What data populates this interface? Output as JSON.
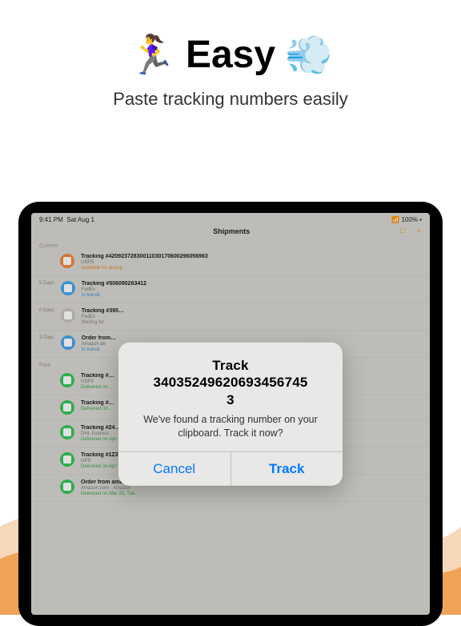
{
  "hero": {
    "emoji_left": "🏃‍♀️",
    "title": "Easy",
    "emoji_right": "💨",
    "subtitle": "Paste tracking numbers easily"
  },
  "status": {
    "time": "9:41 PM",
    "date": "Sat Aug 1",
    "wifi": "📶",
    "battery": "100%"
  },
  "header": {
    "title": "Shipments"
  },
  "sections": {
    "current": "Current",
    "past": "Past"
  },
  "current": [
    {
      "badge": "orange",
      "days": "",
      "title": "Tracking #42092372830011030170600296056963",
      "carrier": "USPS",
      "status": "Available for pickup",
      "statusClass": "st-orange"
    },
    {
      "badge": "blue",
      "days": "5 Days",
      "title": "Tracking #506090263412",
      "carrier": "FedEx",
      "status": "In transit",
      "statusClass": "st-blue"
    },
    {
      "badge": "grey",
      "days": "0 Days",
      "title": "Tracking #395…",
      "carrier": "FedEx",
      "status": "Waiting for",
      "statusClass": "st-grey"
    },
    {
      "badge": "blue",
      "days": "3 Days",
      "title": "Order from…",
      "carrier": "Amazon.de",
      "status": "In transit",
      "statusClass": "st-blue"
    }
  ],
  "past": [
    {
      "badge": "green",
      "title": "Tracking #…",
      "carrier": "USPS",
      "status": "Delivered on…",
      "statusClass": "st-green"
    },
    {
      "badge": "green",
      "title": "Tracking #…",
      "carrier": "",
      "status": "Delivered on…",
      "statusClass": "st-green"
    },
    {
      "badge": "green",
      "title": "Tracking #24…",
      "carrier": "DHL Express",
      "status": "Delivered on Apr 12, Mon.",
      "statusClass": "st-green"
    },
    {
      "badge": "green",
      "title": "Tracking #1Z3Y189000311256771",
      "carrier": "UPS",
      "status": "Delivered on Apr 12, Mon.",
      "statusClass": "st-green"
    },
    {
      "badge": "green",
      "title": "Order from amazon.fr #407-5921077-0449159",
      "carrier": "Amazon.com · Amazon",
      "status": "Delivered on Mar 23, Tue.",
      "statusClass": "st-green"
    }
  ],
  "alert": {
    "title_line1": "Track",
    "title_line2": "34035249620693456745",
    "title_line3": "3",
    "message": "We've found a tracking number on your clipboard. Track it now?",
    "cancel": "Cancel",
    "confirm": "Track"
  }
}
